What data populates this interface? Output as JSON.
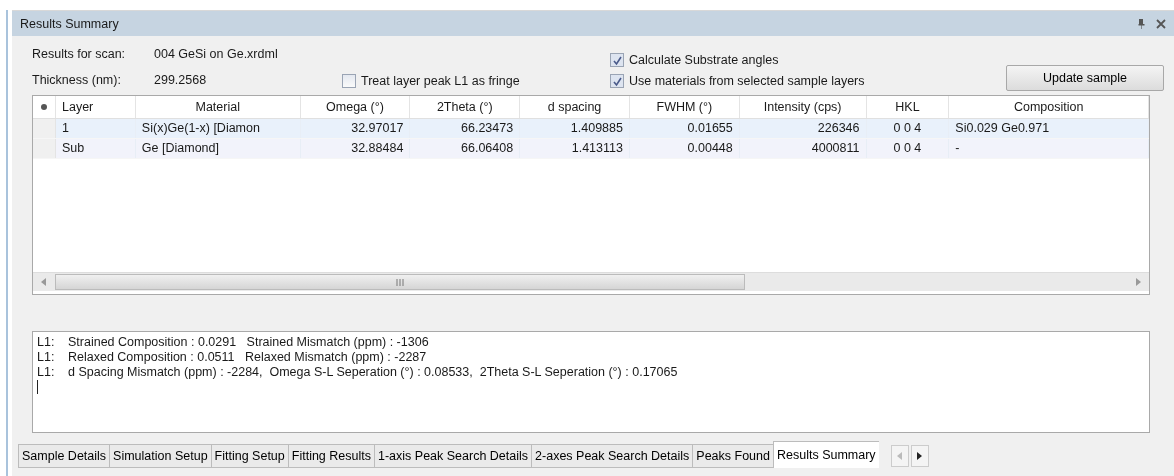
{
  "panel": {
    "title": "Results Summary"
  },
  "info": [
    {
      "label": "Results for scan:",
      "value": "004 GeSi on Ge.xrdml"
    },
    {
      "label": "Thickness (nm):",
      "value": "299.2568"
    }
  ],
  "options": [
    {
      "label": "Treat layer peak L1 as fringe",
      "checked": false
    },
    {
      "label": "Calculate Substrate angles",
      "checked": true
    },
    {
      "label": "Use materials from selected sample layers",
      "checked": true
    }
  ],
  "update_button": "Update sample",
  "table": {
    "columns": [
      "Layer",
      "Material",
      "Omega (°)",
      "2Theta (°)",
      "d spacing",
      "FWHM (°)",
      "Intensity (cps)",
      "HKL",
      "Composition"
    ],
    "rows": [
      [
        "1",
        "Si(x)Ge(1-x) [Diamon",
        "32.97017",
        "66.23473",
        "1.409885",
        "0.01655",
        "226346",
        "0 0 4",
        "Si0.029 Ge0.971"
      ],
      [
        "Sub",
        "Ge [Diamond]",
        "32.88484",
        "66.06408",
        "1.413113",
        "0.00448",
        "4000811",
        "0 0 4",
        "-"
      ]
    ]
  },
  "log": [
    {
      "prefix": "L1:",
      "text": "Strained Composition : 0.0291   Strained Mismatch (ppm) : -1306"
    },
    {
      "prefix": "L1:",
      "text": "Relaxed Composition : 0.0511   Relaxed Mismatch (ppm) : -2287"
    },
    {
      "prefix": "L1:",
      "text": "d Spacing Mismatch (ppm) : -2284,  Omega S-L Seperation (°) : 0.08533,  2Theta S-L Seperation (°) : 0.17065"
    }
  ],
  "tabs": [
    {
      "label": "Sample Details",
      "selected": false
    },
    {
      "label": "Simulation Setup",
      "selected": false
    },
    {
      "label": "Fitting Setup",
      "selected": false
    },
    {
      "label": "Fitting Results",
      "selected": false
    },
    {
      "label": "1-axis Peak Search Details",
      "selected": false
    },
    {
      "label": "2-axes Peak Search Details",
      "selected": false
    },
    {
      "label": "Peaks Found",
      "selected": false
    },
    {
      "label": "Results Summary",
      "selected": true
    }
  ]
}
